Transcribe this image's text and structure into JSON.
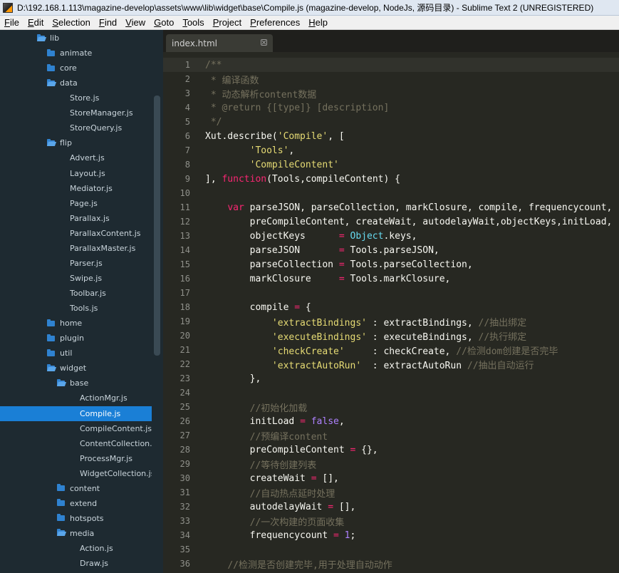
{
  "window": {
    "title": "D:\\192.168.1.113\\magazine-develop\\assets\\www\\lib\\widget\\base\\Compile.js (magazine-develop, NodeJs, 源码目录) - Sublime Text 2 (UNREGISTERED)"
  },
  "menu": [
    {
      "label": "File",
      "acc": "F",
      "rest": "ile"
    },
    {
      "label": "Edit",
      "acc": "E",
      "rest": "dit"
    },
    {
      "label": "Selection",
      "acc": "S",
      "rest": "election"
    },
    {
      "label": "Find",
      "acc": "F",
      "rest": "ind"
    },
    {
      "label": "View",
      "acc": "V",
      "rest": "iew"
    },
    {
      "label": "Goto",
      "acc": "G",
      "rest": "oto"
    },
    {
      "label": "Tools",
      "acc": "T",
      "rest": "ools"
    },
    {
      "label": "Project",
      "acc": "P",
      "rest": "roject"
    },
    {
      "label": "Preferences",
      "acc": "P",
      "rest": "references"
    },
    {
      "label": "Help",
      "acc": "H",
      "rest": "elp"
    }
  ],
  "sidebar": {
    "items": [
      {
        "label": "lib",
        "type": "folder-open",
        "depth": 0
      },
      {
        "label": "animate",
        "type": "folder",
        "depth": 1
      },
      {
        "label": "core",
        "type": "folder",
        "depth": 1
      },
      {
        "label": "data",
        "type": "folder-open",
        "depth": 1
      },
      {
        "label": "Store.js",
        "type": "file",
        "depth": 2
      },
      {
        "label": "StoreManager.js",
        "type": "file",
        "depth": 2
      },
      {
        "label": "StoreQuery.js",
        "type": "file",
        "depth": 2
      },
      {
        "label": "flip",
        "type": "folder-open",
        "depth": 1
      },
      {
        "label": "Advert.js",
        "type": "file",
        "depth": 2
      },
      {
        "label": "Layout.js",
        "type": "file",
        "depth": 2
      },
      {
        "label": "Mediator.js",
        "type": "file",
        "depth": 2
      },
      {
        "label": "Page.js",
        "type": "file",
        "depth": 2
      },
      {
        "label": "Parallax.js",
        "type": "file",
        "depth": 2
      },
      {
        "label": "ParallaxContent.js",
        "type": "file",
        "depth": 2
      },
      {
        "label": "ParallaxMaster.js",
        "type": "file",
        "depth": 2
      },
      {
        "label": "Parser.js",
        "type": "file",
        "depth": 2
      },
      {
        "label": "Swipe.js",
        "type": "file",
        "depth": 2
      },
      {
        "label": "Toolbar.js",
        "type": "file",
        "depth": 2
      },
      {
        "label": "Tools.js",
        "type": "file",
        "depth": 2
      },
      {
        "label": "home",
        "type": "folder",
        "depth": 1
      },
      {
        "label": "plugin",
        "type": "folder",
        "depth": 1
      },
      {
        "label": "util",
        "type": "folder",
        "depth": 1
      },
      {
        "label": "widget",
        "type": "folder-open",
        "depth": 1
      },
      {
        "label": "base",
        "type": "folder-open",
        "depth": 2
      },
      {
        "label": "ActionMgr.js",
        "type": "file",
        "depth": 3
      },
      {
        "label": "Compile.js",
        "type": "file",
        "depth": 3,
        "selected": true
      },
      {
        "label": "CompileContent.js",
        "type": "file",
        "depth": 3
      },
      {
        "label": "ContentCollection.j",
        "type": "file",
        "depth": 3
      },
      {
        "label": "ProcessMgr.js",
        "type": "file",
        "depth": 3
      },
      {
        "label": "WidgetCollection.js",
        "type": "file",
        "depth": 3
      },
      {
        "label": "content",
        "type": "folder",
        "depth": 2
      },
      {
        "label": "extend",
        "type": "folder",
        "depth": 2
      },
      {
        "label": "hotspots",
        "type": "folder",
        "depth": 2
      },
      {
        "label": "media",
        "type": "folder-open",
        "depth": 2
      },
      {
        "label": "Action.js",
        "type": "file",
        "depth": 3
      },
      {
        "label": "Draw.js",
        "type": "file",
        "depth": 3
      }
    ]
  },
  "tabs": [
    {
      "label": "index.html"
    }
  ],
  "editor": {
    "lines": [
      {
        "n": "1",
        "tokens": [
          [
            "c",
            "/**"
          ]
        ]
      },
      {
        "n": "2",
        "tokens": [
          [
            "c",
            " * 编译函数"
          ]
        ]
      },
      {
        "n": "3",
        "tokens": [
          [
            "c",
            " * 动态解析content数据"
          ]
        ]
      },
      {
        "n": "4",
        "tokens": [
          [
            "c",
            " * @return {[type]} [description]"
          ]
        ]
      },
      {
        "n": "5",
        "tokens": [
          [
            "c",
            " */"
          ]
        ]
      },
      {
        "n": "6",
        "tokens": [
          [
            "p",
            "Xut.describe("
          ],
          [
            "s",
            "'Compile'"
          ],
          [
            "p",
            ", ["
          ]
        ]
      },
      {
        "n": "7",
        "tokens": [
          [
            "p",
            "        "
          ],
          [
            "s",
            "'Tools'"
          ],
          [
            "p",
            ","
          ]
        ]
      },
      {
        "n": "8",
        "tokens": [
          [
            "p",
            "        "
          ],
          [
            "s",
            "'CompileContent'"
          ]
        ]
      },
      {
        "n": "9",
        "tokens": [
          [
            "p",
            "], "
          ],
          [
            "k",
            "function"
          ],
          [
            "p",
            "(Tools,compileContent) {"
          ]
        ]
      },
      {
        "n": "10",
        "tokens": [
          [
            "p",
            ""
          ]
        ]
      },
      {
        "n": "11",
        "tokens": [
          [
            "p",
            "    "
          ],
          [
            "k",
            "var"
          ],
          [
            "p",
            " parseJSON, parseCollection, markClosure, compile, frequencycount,"
          ]
        ]
      },
      {
        "n": "12",
        "tokens": [
          [
            "p",
            "        preCompileContent, createWait, autodelayWait,objectKeys,initLoad,"
          ]
        ]
      },
      {
        "n": "13",
        "tokens": [
          [
            "p",
            "        objectKeys      "
          ],
          [
            "k",
            "="
          ],
          [
            "p",
            " "
          ],
          [
            "b",
            "Object"
          ],
          [
            "p",
            ".keys,"
          ]
        ]
      },
      {
        "n": "14",
        "tokens": [
          [
            "p",
            "        parseJSON       "
          ],
          [
            "k",
            "="
          ],
          [
            "p",
            " Tools.parseJSON,"
          ]
        ]
      },
      {
        "n": "15",
        "tokens": [
          [
            "p",
            "        parseCollection "
          ],
          [
            "k",
            "="
          ],
          [
            "p",
            " Tools.parseCollection,"
          ]
        ]
      },
      {
        "n": "16",
        "tokens": [
          [
            "p",
            "        markClosure     "
          ],
          [
            "k",
            "="
          ],
          [
            "p",
            " Tools.markClosure,"
          ]
        ]
      },
      {
        "n": "17",
        "tokens": [
          [
            "p",
            ""
          ]
        ]
      },
      {
        "n": "18",
        "tokens": [
          [
            "p",
            "        compile "
          ],
          [
            "k",
            "="
          ],
          [
            "p",
            " {"
          ]
        ]
      },
      {
        "n": "19",
        "tokens": [
          [
            "p",
            "            "
          ],
          [
            "s",
            "'extractBindings'"
          ],
          [
            "p",
            " : extractBindings, "
          ],
          [
            "c",
            "//抽出绑定"
          ]
        ]
      },
      {
        "n": "20",
        "tokens": [
          [
            "p",
            "            "
          ],
          [
            "s",
            "'executeBindings'"
          ],
          [
            "p",
            " : executeBindings, "
          ],
          [
            "c",
            "//执行绑定"
          ]
        ]
      },
      {
        "n": "21",
        "tokens": [
          [
            "p",
            "            "
          ],
          [
            "s",
            "'checkCreate'"
          ],
          [
            "p",
            "     : checkCreate, "
          ],
          [
            "c",
            "//检测dom创建是否完毕"
          ]
        ]
      },
      {
        "n": "22",
        "tokens": [
          [
            "p",
            "            "
          ],
          [
            "s",
            "'extractAutoRun'"
          ],
          [
            "p",
            "  : extractAutoRun "
          ],
          [
            "c",
            "//抽出自动运行"
          ]
        ]
      },
      {
        "n": "23",
        "tokens": [
          [
            "p",
            "        },"
          ]
        ]
      },
      {
        "n": "24",
        "tokens": [
          [
            "p",
            ""
          ]
        ]
      },
      {
        "n": "25",
        "tokens": [
          [
            "p",
            "        "
          ],
          [
            "c",
            "//初始化加载"
          ]
        ]
      },
      {
        "n": "26",
        "tokens": [
          [
            "p",
            "        initLoad "
          ],
          [
            "k",
            "="
          ],
          [
            "p",
            " "
          ],
          [
            "n",
            "false"
          ],
          [
            "p",
            ","
          ]
        ]
      },
      {
        "n": "27",
        "tokens": [
          [
            "p",
            "        "
          ],
          [
            "c",
            "//预编译content"
          ]
        ]
      },
      {
        "n": "28",
        "tokens": [
          [
            "p",
            "        preCompileContent "
          ],
          [
            "k",
            "="
          ],
          [
            "p",
            " {},"
          ]
        ]
      },
      {
        "n": "29",
        "tokens": [
          [
            "p",
            "        "
          ],
          [
            "c",
            "//等待创建列表"
          ]
        ]
      },
      {
        "n": "30",
        "tokens": [
          [
            "p",
            "        createWait "
          ],
          [
            "k",
            "="
          ],
          [
            "p",
            " [],"
          ]
        ]
      },
      {
        "n": "31",
        "tokens": [
          [
            "p",
            "        "
          ],
          [
            "c",
            "//自动热点延时处理"
          ]
        ]
      },
      {
        "n": "32",
        "tokens": [
          [
            "p",
            "        autodelayWait "
          ],
          [
            "k",
            "="
          ],
          [
            "p",
            " [],"
          ]
        ]
      },
      {
        "n": "33",
        "tokens": [
          [
            "p",
            "        "
          ],
          [
            "c",
            "//一次构建的页面收集"
          ]
        ]
      },
      {
        "n": "34",
        "tokens": [
          [
            "p",
            "        frequencycount "
          ],
          [
            "k",
            "="
          ],
          [
            "p",
            " "
          ],
          [
            "n",
            "1"
          ],
          [
            "p",
            ";"
          ]
        ]
      },
      {
        "n": "35",
        "tokens": [
          [
            "p",
            ""
          ]
        ]
      },
      {
        "n": "36",
        "tokens": [
          [
            "p",
            "    "
          ],
          [
            "c",
            "//检测是否创建完毕,用于处理自动动作"
          ]
        ]
      }
    ],
    "active_line": "1"
  },
  "colors": {
    "comment": "#75715e",
    "string": "#e6db74",
    "keyword": "#f92672",
    "builtin": "#66d9ef",
    "number": "#ae81ff",
    "selection": "#1a7fd6"
  }
}
